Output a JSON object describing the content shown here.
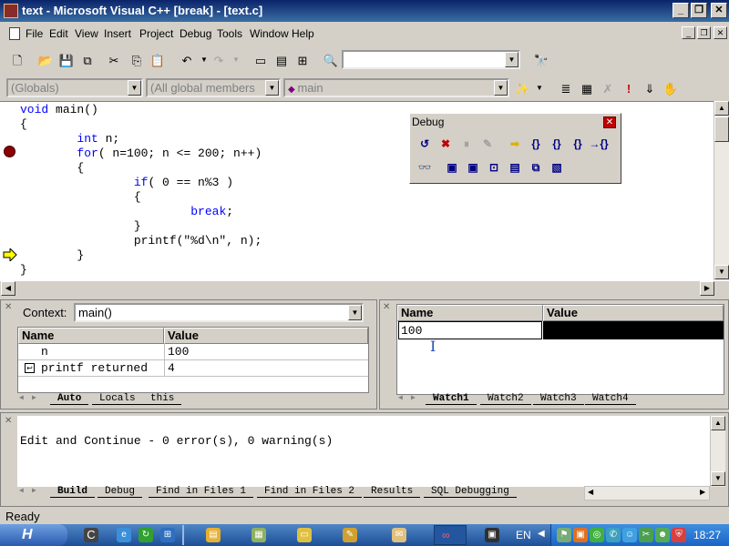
{
  "window": {
    "title": "text - Microsoft Visual C++ [break] - [text.c]"
  },
  "menu": [
    "File",
    "Edit",
    "View",
    "Insert",
    "Project",
    "Debug",
    "Tools",
    "Window",
    "Help"
  ],
  "toolbar": {
    "find_combo_value": "",
    "globals_combo": "(Globals)",
    "members_combo": "(All global members",
    "function_combo": "main"
  },
  "code_lines": [
    "void main()",
    "{",
    "        int n;",
    "        for( n=100; n <= 200; n++)",
    "        {",
    "                if( 0 == n%3 )",
    "                {",
    "                        break;",
    "                }",
    "                printf(\"%d\\n\", n);",
    "        }",
    "}"
  ],
  "debug_toolbar": {
    "title": "Debug"
  },
  "variables_pane": {
    "context_label": "Context:",
    "context_value": "main()",
    "columns": [
      "Name",
      "Value"
    ],
    "rows": [
      {
        "name": "n",
        "value": "100"
      },
      {
        "name": "printf returned",
        "value": "4"
      }
    ],
    "tabs": [
      "Auto",
      "Locals",
      "this"
    ]
  },
  "watch_pane": {
    "columns": [
      "Name",
      "Value"
    ],
    "rows": [
      {
        "name": "100",
        "value": ""
      }
    ],
    "tabs": [
      "Watch1",
      "Watch2",
      "Watch3",
      "Watch4"
    ]
  },
  "output_pane": {
    "message": "Edit and Continue - 0 error(s), 0 warning(s)",
    "tabs": [
      "Build",
      "Debug",
      "Find in Files 1",
      "Find in Files 2",
      "Results",
      "SQL Debugging"
    ]
  },
  "status": {
    "text": "Ready"
  },
  "taskbar": {
    "lang": "EN",
    "clock": "18:27"
  },
  "colors": {
    "keyword": "#0000ff",
    "titlebar": "#0a246a",
    "breakpoint": "#8b0000",
    "arrow": "#ffff00"
  }
}
